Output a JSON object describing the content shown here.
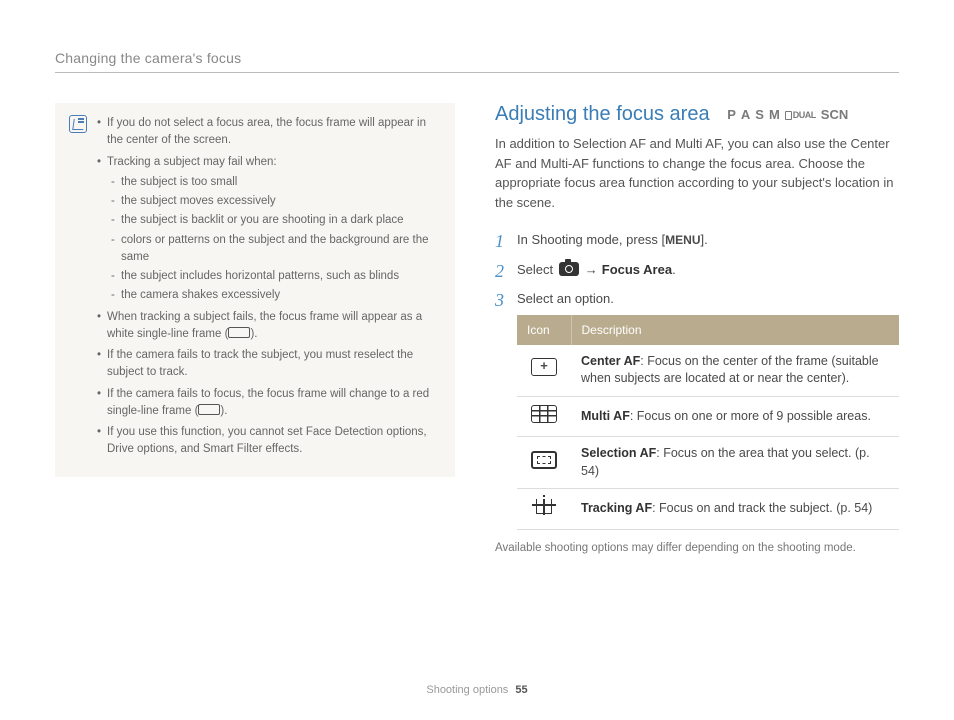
{
  "header": "Changing the camera's focus",
  "note": {
    "items": [
      "If you do not select a focus area, the focus frame will appear in the center of the screen.",
      "Tracking a subject may fail when:",
      "When tracking a subject fails, the focus frame will appear as a white single-line frame (",
      "If the camera fails to track the subject, you must reselect the subject to track.",
      "If the camera fails to focus, the focus frame will change to a red single-line frame (",
      "If you use this function, you cannot set Face Detection options, Drive options, and Smart Filter effects."
    ],
    "item2_close": ").",
    "item4_close": ").",
    "sub": [
      "the subject is too small",
      "the subject moves excessively",
      "the subject is backlit or you are shooting in a dark place",
      "colors or patterns on the subject and the background are the same",
      "the subject includes horizontal patterns, such as blinds",
      "the camera shakes excessively"
    ]
  },
  "section": {
    "title": "Adjusting the focus area",
    "modes": [
      "P",
      "A",
      "S",
      "M"
    ],
    "mode_dual": "DUAL",
    "mode_scn": "SCN",
    "intro": "In addition to Selection AF and Multi AF, you can also use the Center AF and Multi-AF functions to change the focus area. Choose the appropriate focus area function according to your subject's location in the scene."
  },
  "steps": {
    "s1a": "In Shooting mode, press [",
    "s1_menu": "MENU",
    "s1b": "].",
    "s2a": "Select ",
    "s2_arrow": "→",
    "s2_focus": "Focus Area",
    "s2b": ".",
    "s3": "Select an option."
  },
  "table": {
    "h1": "Icon",
    "h2": "Description",
    "rows": [
      {
        "name": "Center AF",
        "desc": ": Focus on the center of the frame (suitable when subjects are located at or near the center)."
      },
      {
        "name": "Multi AF",
        "desc": ": Focus on one or more of 9 possible areas."
      },
      {
        "name": "Selection AF",
        "desc": ": Focus on the area that you select. (p. 54)"
      },
      {
        "name": "Tracking AF",
        "desc": ": Focus on and track the subject. (p. 54)"
      }
    ]
  },
  "footnote": "Available shooting options may differ depending on the shooting mode.",
  "footer": {
    "section": "Shooting options",
    "page": "55"
  }
}
